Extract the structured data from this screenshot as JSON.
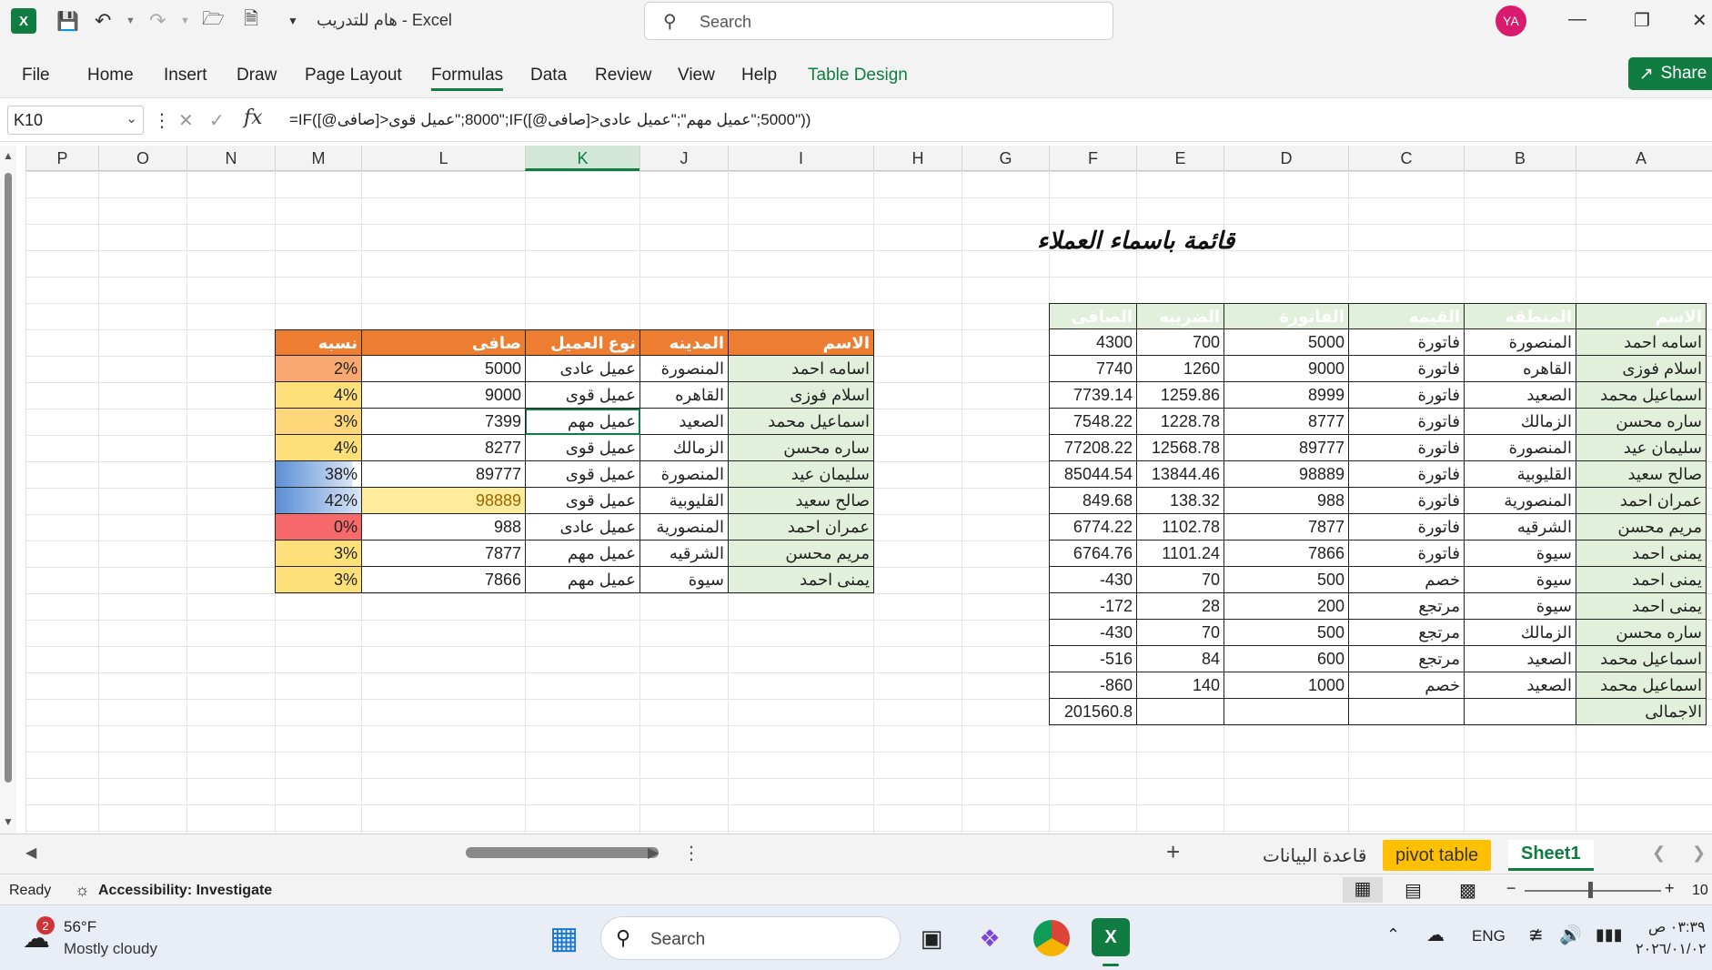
{
  "title_bar": {
    "doc_title": "هام للتدريب  -  Excel",
    "search_placeholder": "Search",
    "avatar_initials": "YA"
  },
  "ribbon": {
    "tabs": [
      "File",
      "Home",
      "Insert",
      "Draw",
      "Page Layout",
      "Formulas",
      "Data",
      "Review",
      "View",
      "Help",
      "Table Design"
    ],
    "active_tab": "Formulas",
    "share_label": "Share"
  },
  "formula_bar": {
    "name_box": "K10",
    "fx_label": "fx",
    "formula": "=IF([@صافى]>8000;\"عميل قوى\";IF([@صافى]>5000;\"عميل مهم\";\"عميل عادى\"))"
  },
  "columns": [
    "P",
    "O",
    "N",
    "M",
    "L",
    "K",
    "J",
    "I",
    "H",
    "G",
    "F",
    "E",
    "D",
    "C",
    "B",
    "A"
  ],
  "selected_column": "K",
  "sheet_title": "قائمة باسماء العملاء",
  "right_table": {
    "headers": [
      "الاسم",
      "المنطقه",
      "القيمه",
      "الفاتورة",
      "الضريبه",
      "الصافى"
    ],
    "rows": [
      [
        "اسامه احمد",
        "المنصورة",
        "فاتورة",
        "5000",
        "700",
        "4300"
      ],
      [
        "اسلام فوزى",
        "القاهره",
        "فاتورة",
        "9000",
        "1260",
        "7740"
      ],
      [
        "اسماعيل محمد",
        "الصعيد",
        "فاتورة",
        "8999",
        "1259.86",
        "7739.14"
      ],
      [
        "ساره محسن",
        "الزمالك",
        "فاتورة",
        "8777",
        "1228.78",
        "7548.22"
      ],
      [
        "سليمان عيد",
        "المنصورة",
        "فاتورة",
        "89777",
        "12568.78",
        "77208.22"
      ],
      [
        "صالح سعيد",
        "القليوبية",
        "فاتورة",
        "98889",
        "13844.46",
        "85044.54"
      ],
      [
        "عمران احمد",
        "المنصورية",
        "فاتورة",
        "988",
        "138.32",
        "849.68"
      ],
      [
        "مريم محسن",
        "الشرقيه",
        "فاتورة",
        "7877",
        "1102.78",
        "6774.22"
      ],
      [
        "يمنى احمد",
        "سيوة",
        "فاتورة",
        "7866",
        "1101.24",
        "6764.76"
      ],
      [
        "يمنى احمد",
        "سيوة",
        "خصم",
        "500",
        "70",
        "-430"
      ],
      [
        "يمنى احمد",
        "سيوة",
        "مرتجع",
        "200",
        "28",
        "-172"
      ],
      [
        "ساره محسن",
        "الزمالك",
        "مرتجع",
        "500",
        "70",
        "-430"
      ],
      [
        "اسماعيل محمد",
        "الصعيد",
        "مرتجع",
        "600",
        "84",
        "-516"
      ],
      [
        "اسماعيل محمد",
        "الصعيد",
        "خصم",
        "1000",
        "140",
        "-860"
      ]
    ],
    "total_label": "الاجمالى",
    "total_value": "201560.8"
  },
  "left_table": {
    "headers": [
      "الاسم",
      "المدينه",
      "نوع العميل",
      "صافى",
      "نسبه"
    ],
    "rows": [
      [
        "اسامه احمد",
        "المنصورة",
        "عميل عادى",
        "5000",
        "2%"
      ],
      [
        "اسلام فوزى",
        "القاهره",
        "عميل قوى",
        "9000",
        "4%"
      ],
      [
        "اسماعيل محمد",
        "الصعيد",
        "عميل مهم",
        "7399",
        "3%"
      ],
      [
        "ساره محسن",
        "الزمالك",
        "عميل قوى",
        "8277",
        "4%"
      ],
      [
        "سليمان عيد",
        "المنصورة",
        "عميل قوى",
        "89777",
        "38%"
      ],
      [
        "صالح سعيد",
        "القليوبية",
        "عميل قوى",
        "98889",
        "42%"
      ],
      [
        "عمران احمد",
        "المنصورية",
        "عميل عادى",
        "988",
        "0%"
      ],
      [
        "مريم محسن",
        "الشرقيه",
        "عميل مهم",
        "7877",
        "3%"
      ],
      [
        "يمنى احمد",
        "سيوة",
        "عميل مهم",
        "7866",
        "3%"
      ]
    ],
    "ratio_colors": [
      "#f8a870",
      "#fde07a",
      "#fdd77a",
      "#fde07a",
      "#c7d7ee",
      "#c7d7ee",
      "#f8696b",
      "#fde07a",
      "#fde07a"
    ],
    "ratio_bar_fraction": [
      0.05,
      0.09,
      0.07,
      0.09,
      0.9,
      1.0,
      0.0,
      0.07,
      0.07
    ],
    "highlight_row": 5
  },
  "sheet_tabs": [
    "Sheet1",
    "pivot table",
    "قاعدة البيانات"
  ],
  "active_sheet": "Sheet1",
  "add_sheet_label": "+",
  "status_bar": {
    "ready": "Ready",
    "accessibility": "Accessibility: Investigate",
    "zoom": "10"
  },
  "taskbar": {
    "weather_temp": "56°F",
    "weather_desc": "Mostly cloudy",
    "weather_badge": "2",
    "search_label": "Search",
    "language": "ENG",
    "time": "٠٣:٣٩ ص",
    "date": "٢٠٢٦/٠١/٠٢"
  },
  "colors": {
    "excel_green": "#107c41",
    "orange_header": "#ed7d31",
    "green_header": "#e2efda",
    "avatar": "#d81b6f",
    "pivot_tab": "#ffc000"
  }
}
